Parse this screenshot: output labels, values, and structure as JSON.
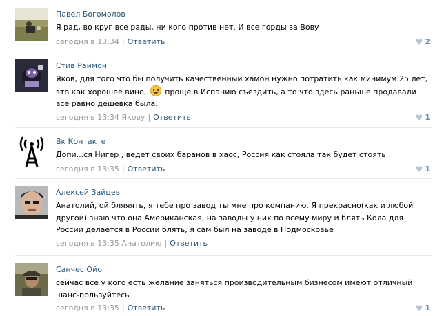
{
  "comments": [
    {
      "author": "Павел Богомолов",
      "lines": [
        "Я рад, во круг все рады, ни кого против нет. И все горды за Вову"
      ],
      "time": "сегодня в 13:34",
      "reply_to": "",
      "reply_label": "Ответить",
      "likes": "2"
    },
    {
      "author": "Стив Раймон",
      "line1": "Яков, для того что бы получить качественный хамон нужно потратить как минимум 25 лет,",
      "line2_a": "это как хорошее вино,",
      "line2_b": "прощё в Испанию съездить, а то что здесь раньше продавали",
      "line3": "всё равно дешёвка была.",
      "time": "сегодня в 13:34",
      "reply_to": "Якову",
      "reply_label": "Ответить",
      "likes": "1"
    },
    {
      "author": "Вк Контакте",
      "lines": [
        "Допи...ся Нигер , ведет своих баранов в хаос, Россия как стояла так будет стоять."
      ],
      "time": "сегодня в 13:35",
      "reply_to": "",
      "reply_label": "Ответить",
      "likes": "1"
    },
    {
      "author": "Алексей Зайцев",
      "lines": [
        "Анатолий, ой бляяять, я тебе про завод ты мне про компанию. Я прекрасно(как и любой",
        "другой) знаю что она Американская, на заводы у них по всему миру и блять Кола для",
        "России делается в России блять, я сам был на заводе в Подмосковье"
      ],
      "time": "сегодня в 13:35",
      "reply_to": "Анатолию",
      "reply_label": "Ответить",
      "likes": ""
    },
    {
      "author": "Санчес Ойо",
      "lines": [
        "сейчас все у кого есть желание заняться производительным бизнесом имеют отличный",
        "шанс-пользуйтесь"
      ],
      "time": "сегодня в 13:35",
      "reply_to": "",
      "reply_label": "Ответить",
      "likes": "1"
    }
  ],
  "icons": {
    "like": "heart-icon",
    "smile": "smile-emoji-icon"
  },
  "colors": {
    "link": "#2b587a",
    "meta": "#999999",
    "like": "#6b8db2",
    "divider": "#e7e8ec"
  }
}
